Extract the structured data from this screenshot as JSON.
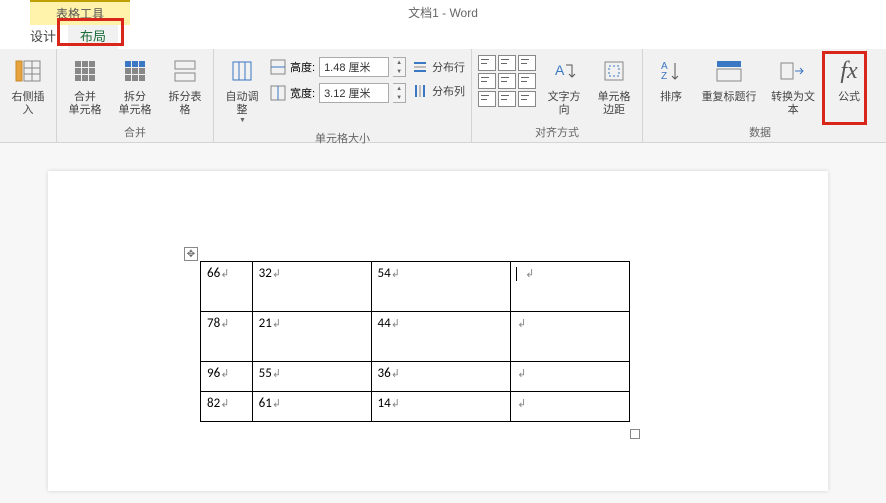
{
  "title": "文档1 - Word",
  "context_tab": "表格工具",
  "tabs": {
    "design": "设计",
    "layout": "布局"
  },
  "ribbon": {
    "insert_right": "右侧插入",
    "merge_cells": "合并\n单元格",
    "split_cells": "拆分\n单元格",
    "split_table": "拆分表格",
    "merge_group": "合并",
    "autofit": "自动调整",
    "height_label": "高度:",
    "height_value": "1.48 厘米",
    "width_label": "宽度:",
    "width_value": "3.12 厘米",
    "dist_rows": "分布行",
    "dist_cols": "分布列",
    "size_group": "单元格大小",
    "text_dir": "文字方向",
    "cell_margins": "单元格\n边距",
    "align_group": "对齐方式",
    "sort": "排序",
    "repeat_header": "重复标题行",
    "convert_text": "转换为文本",
    "formula": "公式",
    "data_group": "数据"
  },
  "table": {
    "rows": [
      {
        "c1": "66",
        "c2": "32",
        "c3": "54",
        "c4": ""
      },
      {
        "c1": "78",
        "c2": "21",
        "c3": "44",
        "c4": ""
      },
      {
        "c1": "96",
        "c2": "55",
        "c3": "36",
        "c4": ""
      },
      {
        "c1": "82",
        "c2": "61",
        "c3": "14",
        "c4": ""
      }
    ]
  }
}
